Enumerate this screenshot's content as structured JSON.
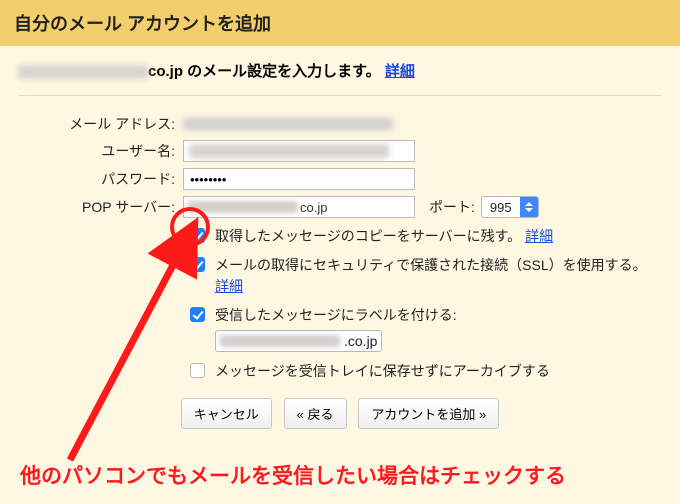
{
  "title": "自分のメール アカウントを追加",
  "subheading": {
    "suffix": "co.jp のメール設定を入力します。",
    "details_link": "詳細"
  },
  "labels": {
    "email": "メール アドレス:",
    "username": "ユーザー名:",
    "password": "パスワード:",
    "pop_server": "POP サーバー:",
    "port": "ポート:"
  },
  "values": {
    "password_mask": "••••••••",
    "pop_suffix": "co.jp",
    "port": "995",
    "label_suffix": ".co.jp"
  },
  "options": {
    "leave_copy": {
      "text": "取得したメッセージのコピーをサーバーに残す。",
      "link": "詳細",
      "checked": true
    },
    "ssl": {
      "text": "メールの取得にセキュリティで保護された接続（SSL）を使用する。",
      "link": "詳細",
      "checked": true
    },
    "label": {
      "text": "受信したメッセージにラベルを付ける:",
      "checked": true
    },
    "archive": {
      "text": "メッセージを受信トレイに保存せずにアーカイブする",
      "checked": false
    }
  },
  "buttons": {
    "cancel": "キャンセル",
    "back": "« 戻る",
    "add": "アカウントを追加 »"
  },
  "annotation": "他のパソコンでもメールを受信したい場合はチェックする"
}
